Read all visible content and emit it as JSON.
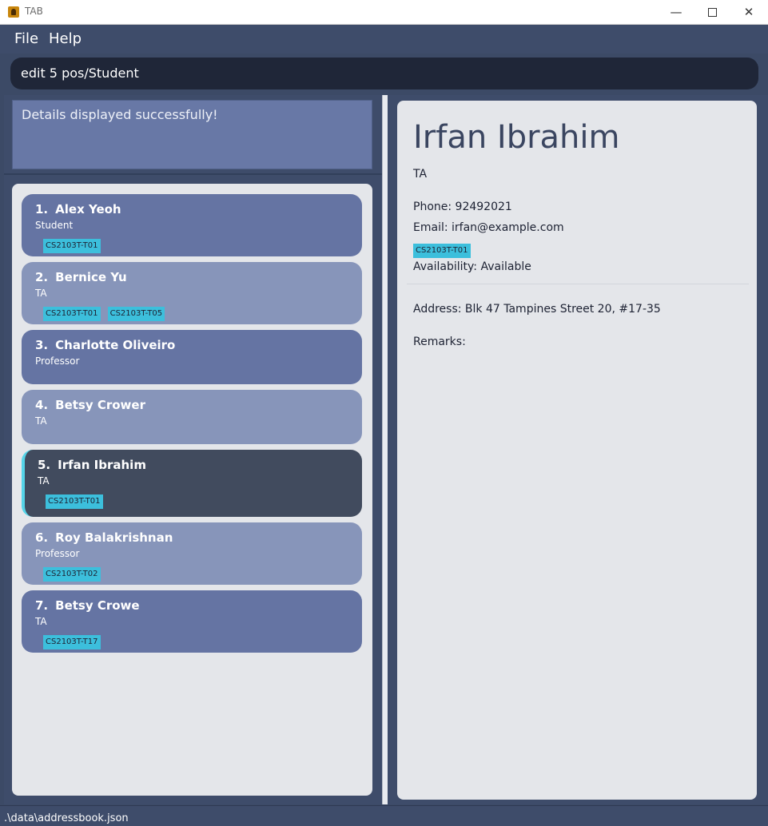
{
  "window": {
    "title": "TAB",
    "minimize_glyph": "—",
    "close_glyph": "✕"
  },
  "menu": {
    "file": "File",
    "help": "Help"
  },
  "command": {
    "value": "edit 5 pos/Student"
  },
  "result": {
    "message": "Details displayed successfully!"
  },
  "persons": [
    {
      "index": "1.",
      "name": "Alex Yeoh",
      "role": "Student",
      "tags": [
        "CS2103T-T01"
      ]
    },
    {
      "index": "2.",
      "name": "Bernice Yu",
      "role": "TA",
      "tags": [
        "CS2103T-T01",
        "CS2103T-T05"
      ]
    },
    {
      "index": "3.",
      "name": "Charlotte Oliveiro",
      "role": "Professor",
      "tags": []
    },
    {
      "index": "4.",
      "name": "Betsy Crower",
      "role": "TA",
      "tags": []
    },
    {
      "index": "5.",
      "name": "Irfan Ibrahim",
      "role": "TA",
      "tags": [
        "CS2103T-T01"
      ]
    },
    {
      "index": "6.",
      "name": "Roy Balakrishnan",
      "role": "Professor",
      "tags": [
        "CS2103T-T02"
      ]
    },
    {
      "index": "7.",
      "name": "Betsy Crowe",
      "role": "TA",
      "tags": [
        "CS2103T-T17"
      ]
    }
  ],
  "detail": {
    "name": "Irfan Ibrahim",
    "role": "TA",
    "phone": "Phone: 92492021",
    "email": "Email: irfan@example.com",
    "tag": "CS2103T-T01",
    "availability": "Availability: Available",
    "address": "Address: Blk 47 Tampines Street 20, #17-35",
    "remarks": "Remarks:"
  },
  "status": {
    "path": ".\\data\\addressbook.json"
  },
  "colors": {
    "accent_tag": "#3cbfdc",
    "selected_card": "#414b5e",
    "selected_marker": "#55d4e8"
  }
}
